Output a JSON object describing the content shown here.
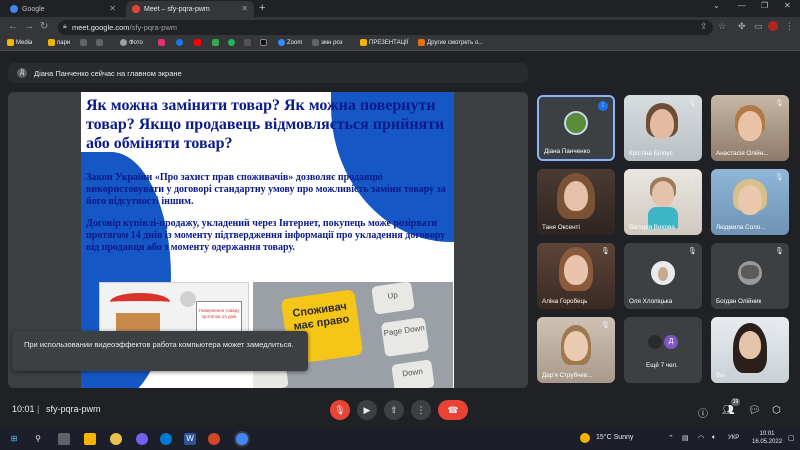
{
  "browser": {
    "tabs": [
      {
        "title": "Google",
        "fav_color": "#4285f4"
      },
      {
        "title": "Meet – sfy-pqra-pwm",
        "fav_color": "#ea4335"
      }
    ],
    "new_tab": "+",
    "url_host": "meet.google.com",
    "url_path": "/sfy-pqra-pwm",
    "bookmarks": [
      {
        "label": "Media",
        "color": "#f4b400"
      },
      {
        "label": "пари",
        "color": "#f4b400"
      },
      {
        "label": "",
        "color": "#5f6368"
      },
      {
        "label": "Фото",
        "color": "#9aa0a6"
      },
      {
        "label": "",
        "color": "#e1306c"
      },
      {
        "label": "",
        "color": "#1877f2"
      },
      {
        "label": "",
        "color": "#ff0000"
      },
      {
        "label": "",
        "color": "#34a853"
      },
      {
        "label": "",
        "color": "#1db954"
      },
      {
        "label": "",
        "color": "#555"
      },
      {
        "label": "Zoom",
        "color": "#2d8cff"
      },
      {
        "label": "эмн роз",
        "color": "#5f6368"
      },
      {
        "label": "ПРЕЗЕНТАЦІЇ",
        "color": "#f4b400"
      },
      {
        "label": "Другие смотреть о...",
        "color": "#e8710a"
      }
    ]
  },
  "banner": {
    "avatar_letter": "Д",
    "text": "Діана Панченко сейчас на главном экране"
  },
  "slide": {
    "title": "Як можна замінити товар? Як можна повернути товар? Якщо продавець відмовляється прийняти або обміняти товар?",
    "para1": "Закон України «Про захист прав споживачів» дозволяє продавцю використовувати у договорі стандартну умову про можливість заміни товару за його відсутності іншим.",
    "para2": "Договір купівлі-продажу, укладений через Інтернет, покупець може розірвати протягом 14 днів із моменту підтвердження інформації про укладення договору від продавця або з моменту одержання товару.",
    "sign_text": "Повернення товару протягом 14 днів",
    "key_text": "Споживач має право",
    "keys": [
      "Up",
      "Page Down",
      "Down"
    ]
  },
  "participants": [
    {
      "name": "Діана Панченко"
    },
    {
      "name": "Крістіна Білоус"
    },
    {
      "name": "Анастасія Олійн..."
    },
    {
      "name": "Таня Оксенті"
    },
    {
      "name": "Вікторія Вихова..."
    },
    {
      "name": "Людмила Соло..."
    },
    {
      "name": "Аліна Горобець"
    },
    {
      "name": "Оля Хлопіцька"
    },
    {
      "name": "Богдан Олійник"
    },
    {
      "name": "Дар'я Струбчев..."
    },
    {
      "name": "Ещё 7 чел.",
      "avatar_letter": "Д"
    },
    {
      "name": "Вы"
    }
  ],
  "toast": "При использовании видеоэффектов работа компьютера может замедлиться.",
  "meetbar": {
    "time": "10:01",
    "separator": "|",
    "code": "sfy-pqra-pwm",
    "participants_count": "19"
  },
  "taskbar": {
    "weather": "15°C  Sunny",
    "lang": "УКР",
    "time": "10:01",
    "date": "16.05.2022"
  }
}
